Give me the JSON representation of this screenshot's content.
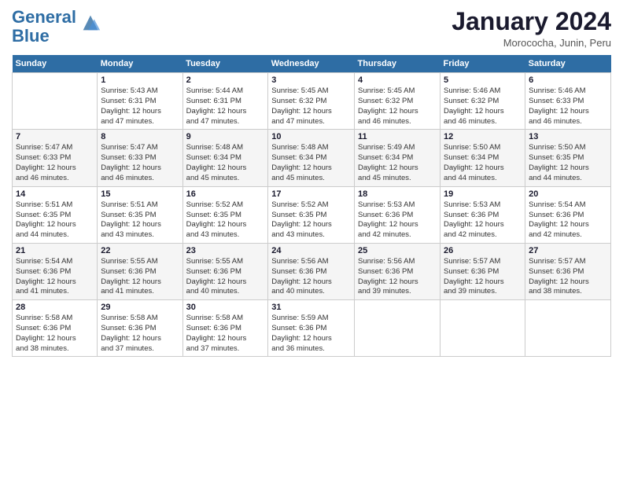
{
  "header": {
    "logo_line1": "General",
    "logo_line2": "Blue",
    "month_title": "January 2024",
    "subtitle": "Morococha, Junin, Peru"
  },
  "weekdays": [
    "Sunday",
    "Monday",
    "Tuesday",
    "Wednesday",
    "Thursday",
    "Friday",
    "Saturday"
  ],
  "weeks": [
    [
      {
        "day": "",
        "info": ""
      },
      {
        "day": "1",
        "info": "Sunrise: 5:43 AM\nSunset: 6:31 PM\nDaylight: 12 hours\nand 47 minutes."
      },
      {
        "day": "2",
        "info": "Sunrise: 5:44 AM\nSunset: 6:31 PM\nDaylight: 12 hours\nand 47 minutes."
      },
      {
        "day": "3",
        "info": "Sunrise: 5:45 AM\nSunset: 6:32 PM\nDaylight: 12 hours\nand 47 minutes."
      },
      {
        "day": "4",
        "info": "Sunrise: 5:45 AM\nSunset: 6:32 PM\nDaylight: 12 hours\nand 46 minutes."
      },
      {
        "day": "5",
        "info": "Sunrise: 5:46 AM\nSunset: 6:32 PM\nDaylight: 12 hours\nand 46 minutes."
      },
      {
        "day": "6",
        "info": "Sunrise: 5:46 AM\nSunset: 6:33 PM\nDaylight: 12 hours\nand 46 minutes."
      }
    ],
    [
      {
        "day": "7",
        "info": "Sunrise: 5:47 AM\nSunset: 6:33 PM\nDaylight: 12 hours\nand 46 minutes."
      },
      {
        "day": "8",
        "info": "Sunrise: 5:47 AM\nSunset: 6:33 PM\nDaylight: 12 hours\nand 46 minutes."
      },
      {
        "day": "9",
        "info": "Sunrise: 5:48 AM\nSunset: 6:34 PM\nDaylight: 12 hours\nand 45 minutes."
      },
      {
        "day": "10",
        "info": "Sunrise: 5:48 AM\nSunset: 6:34 PM\nDaylight: 12 hours\nand 45 minutes."
      },
      {
        "day": "11",
        "info": "Sunrise: 5:49 AM\nSunset: 6:34 PM\nDaylight: 12 hours\nand 45 minutes."
      },
      {
        "day": "12",
        "info": "Sunrise: 5:50 AM\nSunset: 6:34 PM\nDaylight: 12 hours\nand 44 minutes."
      },
      {
        "day": "13",
        "info": "Sunrise: 5:50 AM\nSunset: 6:35 PM\nDaylight: 12 hours\nand 44 minutes."
      }
    ],
    [
      {
        "day": "14",
        "info": "Sunrise: 5:51 AM\nSunset: 6:35 PM\nDaylight: 12 hours\nand 44 minutes."
      },
      {
        "day": "15",
        "info": "Sunrise: 5:51 AM\nSunset: 6:35 PM\nDaylight: 12 hours\nand 43 minutes."
      },
      {
        "day": "16",
        "info": "Sunrise: 5:52 AM\nSunset: 6:35 PM\nDaylight: 12 hours\nand 43 minutes."
      },
      {
        "day": "17",
        "info": "Sunrise: 5:52 AM\nSunset: 6:35 PM\nDaylight: 12 hours\nand 43 minutes."
      },
      {
        "day": "18",
        "info": "Sunrise: 5:53 AM\nSunset: 6:36 PM\nDaylight: 12 hours\nand 42 minutes."
      },
      {
        "day": "19",
        "info": "Sunrise: 5:53 AM\nSunset: 6:36 PM\nDaylight: 12 hours\nand 42 minutes."
      },
      {
        "day": "20",
        "info": "Sunrise: 5:54 AM\nSunset: 6:36 PM\nDaylight: 12 hours\nand 42 minutes."
      }
    ],
    [
      {
        "day": "21",
        "info": "Sunrise: 5:54 AM\nSunset: 6:36 PM\nDaylight: 12 hours\nand 41 minutes."
      },
      {
        "day": "22",
        "info": "Sunrise: 5:55 AM\nSunset: 6:36 PM\nDaylight: 12 hours\nand 41 minutes."
      },
      {
        "day": "23",
        "info": "Sunrise: 5:55 AM\nSunset: 6:36 PM\nDaylight: 12 hours\nand 40 minutes."
      },
      {
        "day": "24",
        "info": "Sunrise: 5:56 AM\nSunset: 6:36 PM\nDaylight: 12 hours\nand 40 minutes."
      },
      {
        "day": "25",
        "info": "Sunrise: 5:56 AM\nSunset: 6:36 PM\nDaylight: 12 hours\nand 39 minutes."
      },
      {
        "day": "26",
        "info": "Sunrise: 5:57 AM\nSunset: 6:36 PM\nDaylight: 12 hours\nand 39 minutes."
      },
      {
        "day": "27",
        "info": "Sunrise: 5:57 AM\nSunset: 6:36 PM\nDaylight: 12 hours\nand 38 minutes."
      }
    ],
    [
      {
        "day": "28",
        "info": "Sunrise: 5:58 AM\nSunset: 6:36 PM\nDaylight: 12 hours\nand 38 minutes."
      },
      {
        "day": "29",
        "info": "Sunrise: 5:58 AM\nSunset: 6:36 PM\nDaylight: 12 hours\nand 37 minutes."
      },
      {
        "day": "30",
        "info": "Sunrise: 5:58 AM\nSunset: 6:36 PM\nDaylight: 12 hours\nand 37 minutes."
      },
      {
        "day": "31",
        "info": "Sunrise: 5:59 AM\nSunset: 6:36 PM\nDaylight: 12 hours\nand 36 minutes."
      },
      {
        "day": "",
        "info": ""
      },
      {
        "day": "",
        "info": ""
      },
      {
        "day": "",
        "info": ""
      }
    ]
  ]
}
